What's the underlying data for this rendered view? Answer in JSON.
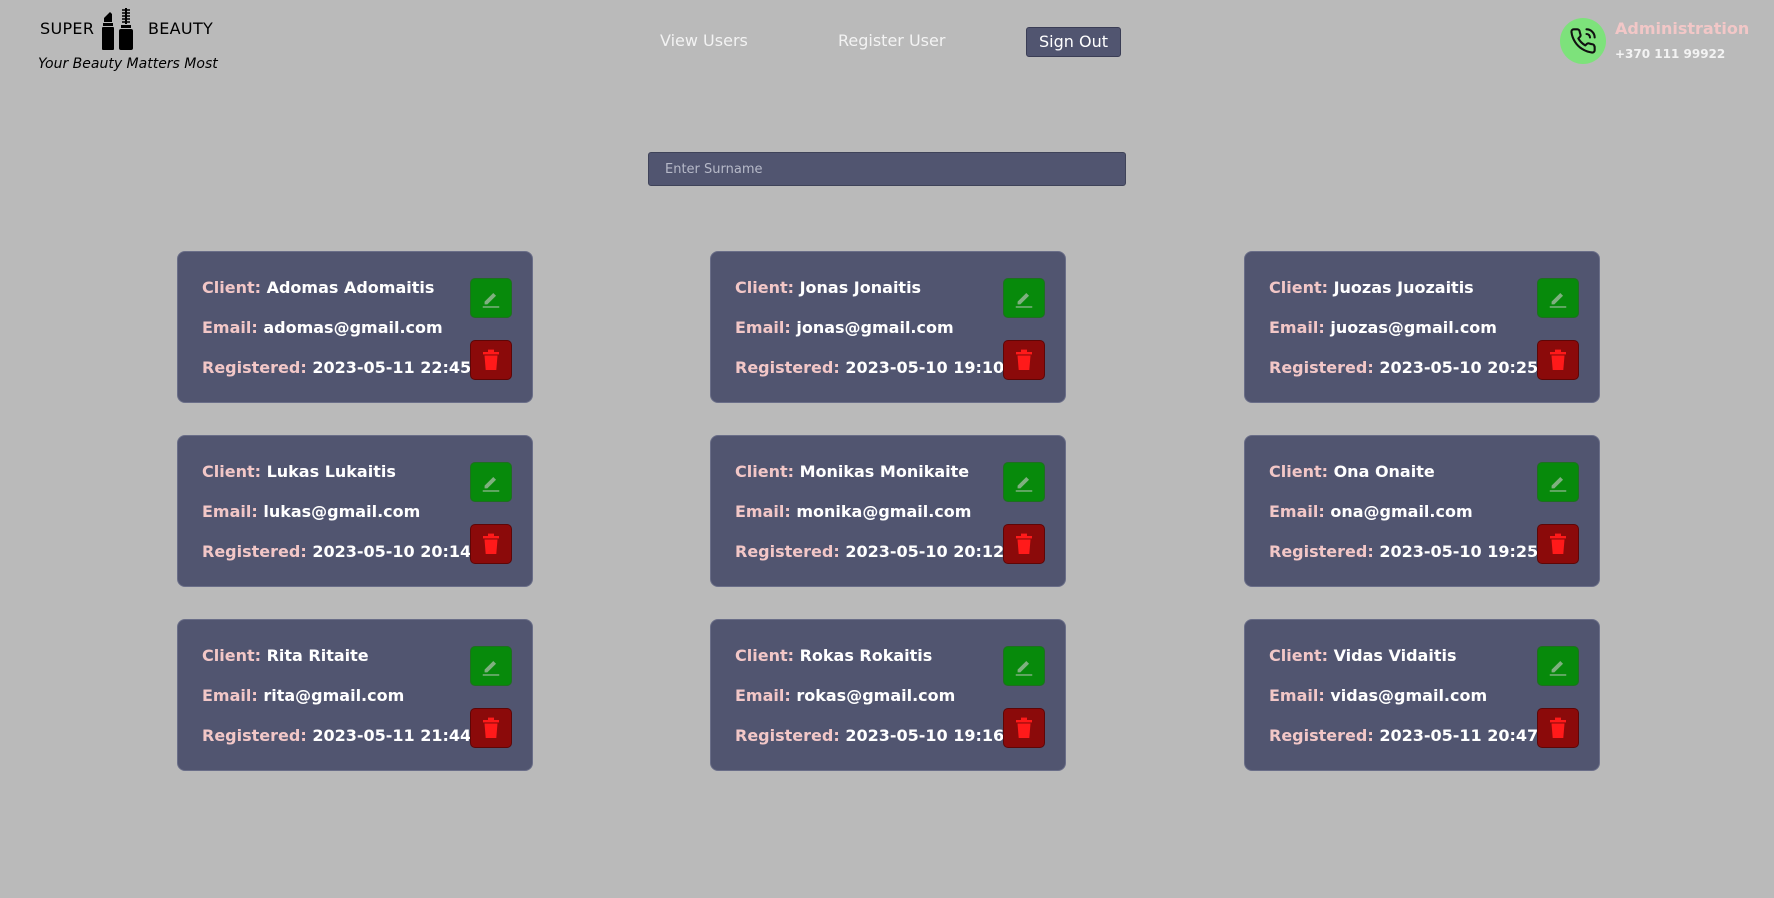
{
  "brand": {
    "left_word": "SUPER",
    "right_word": "BEAUTY",
    "tagline": "Your Beauty Matters Most",
    "icon": "lipstick-mascara-icon"
  },
  "nav": {
    "view_users": "View Users",
    "register_user": "Register User",
    "sign_out": "Sign Out"
  },
  "admin": {
    "title": "Administration",
    "phone": "+370 111 99922",
    "icon": "phone-icon"
  },
  "search": {
    "placeholder": "Enter Surname",
    "value": ""
  },
  "labels": {
    "client": "Client:",
    "email": "Email:",
    "registered": "Registered:"
  },
  "colors": {
    "background": "#bababa",
    "card": "#515570",
    "label": "#f2c7c7",
    "edit_button": "#078a0b",
    "delete_button": "#8b0a0a",
    "phone_circle": "#7de27b"
  },
  "clients": [
    {
      "name": "Adomas Adomaitis",
      "email": "adomas@gmail.com",
      "registered": "2023-05-11 22:45"
    },
    {
      "name": "Jonas Jonaitis",
      "email": "jonas@gmail.com",
      "registered": "2023-05-10 19:10"
    },
    {
      "name": "Juozas Juozaitis",
      "email": "juozas@gmail.com",
      "registered": "2023-05-10 20:25"
    },
    {
      "name": "Lukas Lukaitis",
      "email": "lukas@gmail.com",
      "registered": "2023-05-10 20:14"
    },
    {
      "name": "Monikas Monikaite",
      "email": "monika@gmail.com",
      "registered": "2023-05-10 20:12"
    },
    {
      "name": "Ona Onaite",
      "email": "ona@gmail.com",
      "registered": "2023-05-10 19:25"
    },
    {
      "name": "Rita Ritaite",
      "email": "rita@gmail.com",
      "registered": "2023-05-11 21:44"
    },
    {
      "name": "Rokas Rokaitis",
      "email": "rokas@gmail.com",
      "registered": "2023-05-10 19:16"
    },
    {
      "name": "Vidas Vidaitis",
      "email": "vidas@gmail.com",
      "registered": "2023-05-11 20:47"
    }
  ]
}
